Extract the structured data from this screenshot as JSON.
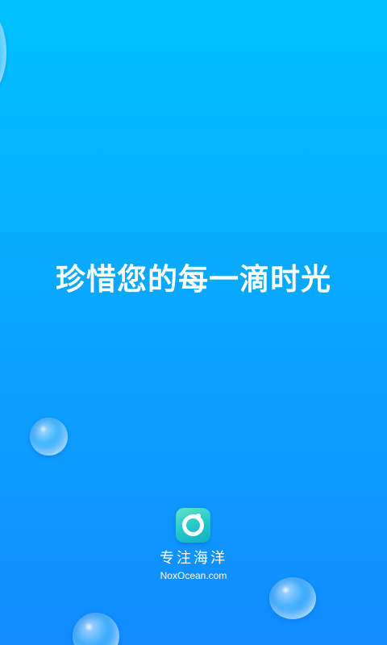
{
  "splash": {
    "slogan": "珍惜您的每一滴时光",
    "brand_name_cn": "专注海洋",
    "brand_domain": "NoxOcean.com",
    "logo_icon": "nox-ocean-logo-icon",
    "colors": {
      "background_top": "#00C3FF",
      "background_bottom": "#118CFF",
      "text": "#FFFFFF",
      "logo": "#21C7C9"
    }
  }
}
